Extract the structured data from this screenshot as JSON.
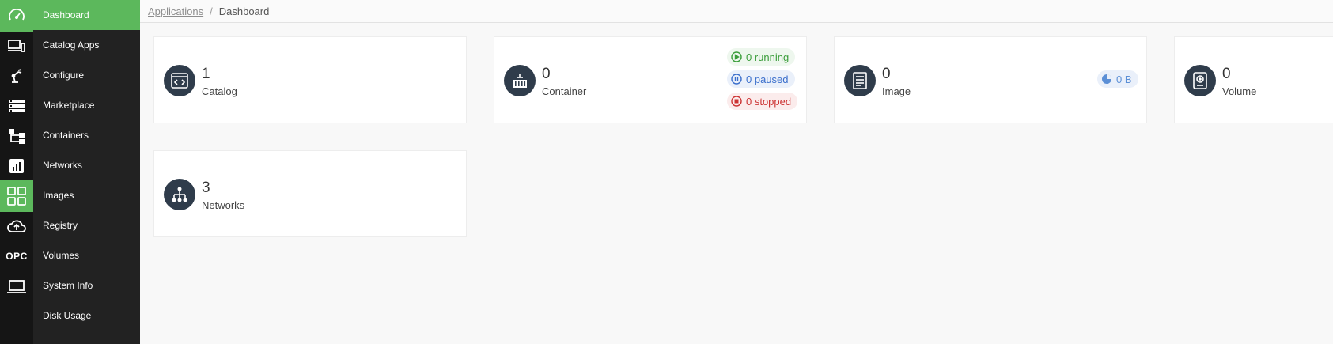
{
  "breadcrumb": {
    "parent": "Applications",
    "separator": "/",
    "current": "Dashboard"
  },
  "rail": {
    "opc_text": "OPC"
  },
  "nav": {
    "items": [
      {
        "label": "Dashboard",
        "icon": "speedometer-icon",
        "active": true
      },
      {
        "label": "Catalog Apps",
        "icon": "devices-icon",
        "active": false
      },
      {
        "label": "Configure",
        "icon": "robot-arm-icon",
        "active": false
      },
      {
        "label": "Marketplace",
        "icon": "server-stack-icon",
        "active": false
      },
      {
        "label": "Containers",
        "icon": "hierarchy-icon",
        "active": false
      },
      {
        "label": "Networks",
        "icon": "bar-chart-icon",
        "active": false
      },
      {
        "label": "Images",
        "icon": "grid-icon",
        "active": false
      },
      {
        "label": "Registry",
        "icon": "cloud-upload-icon",
        "active": false
      },
      {
        "label": "Volumes",
        "icon": "opc-text-icon",
        "active": false
      },
      {
        "label": "System Info",
        "icon": "laptop-icon",
        "active": false
      },
      {
        "label": "Disk Usage",
        "icon": "",
        "active": false
      }
    ]
  },
  "cards": {
    "catalog": {
      "count": "1",
      "label": "Catalog",
      "icon": "code-window-icon"
    },
    "container": {
      "count": "0",
      "label": "Container",
      "icon": "container-icon",
      "running": "0 running",
      "paused": "0 paused",
      "stopped": "0 stopped"
    },
    "image": {
      "count": "0",
      "label": "Image",
      "icon": "image-file-icon",
      "size": "0 B"
    },
    "volume": {
      "count": "0",
      "label": "Volume",
      "icon": "disk-drive-icon"
    },
    "networks": {
      "count": "3",
      "label": "Networks",
      "icon": "network-tree-icon"
    }
  },
  "colors": {
    "accent": "#5cb85c",
    "running": "#3a9d3a",
    "paused": "#3b6fcc",
    "stopped": "#cc3333",
    "icon_bg": "#2f3c4b"
  }
}
